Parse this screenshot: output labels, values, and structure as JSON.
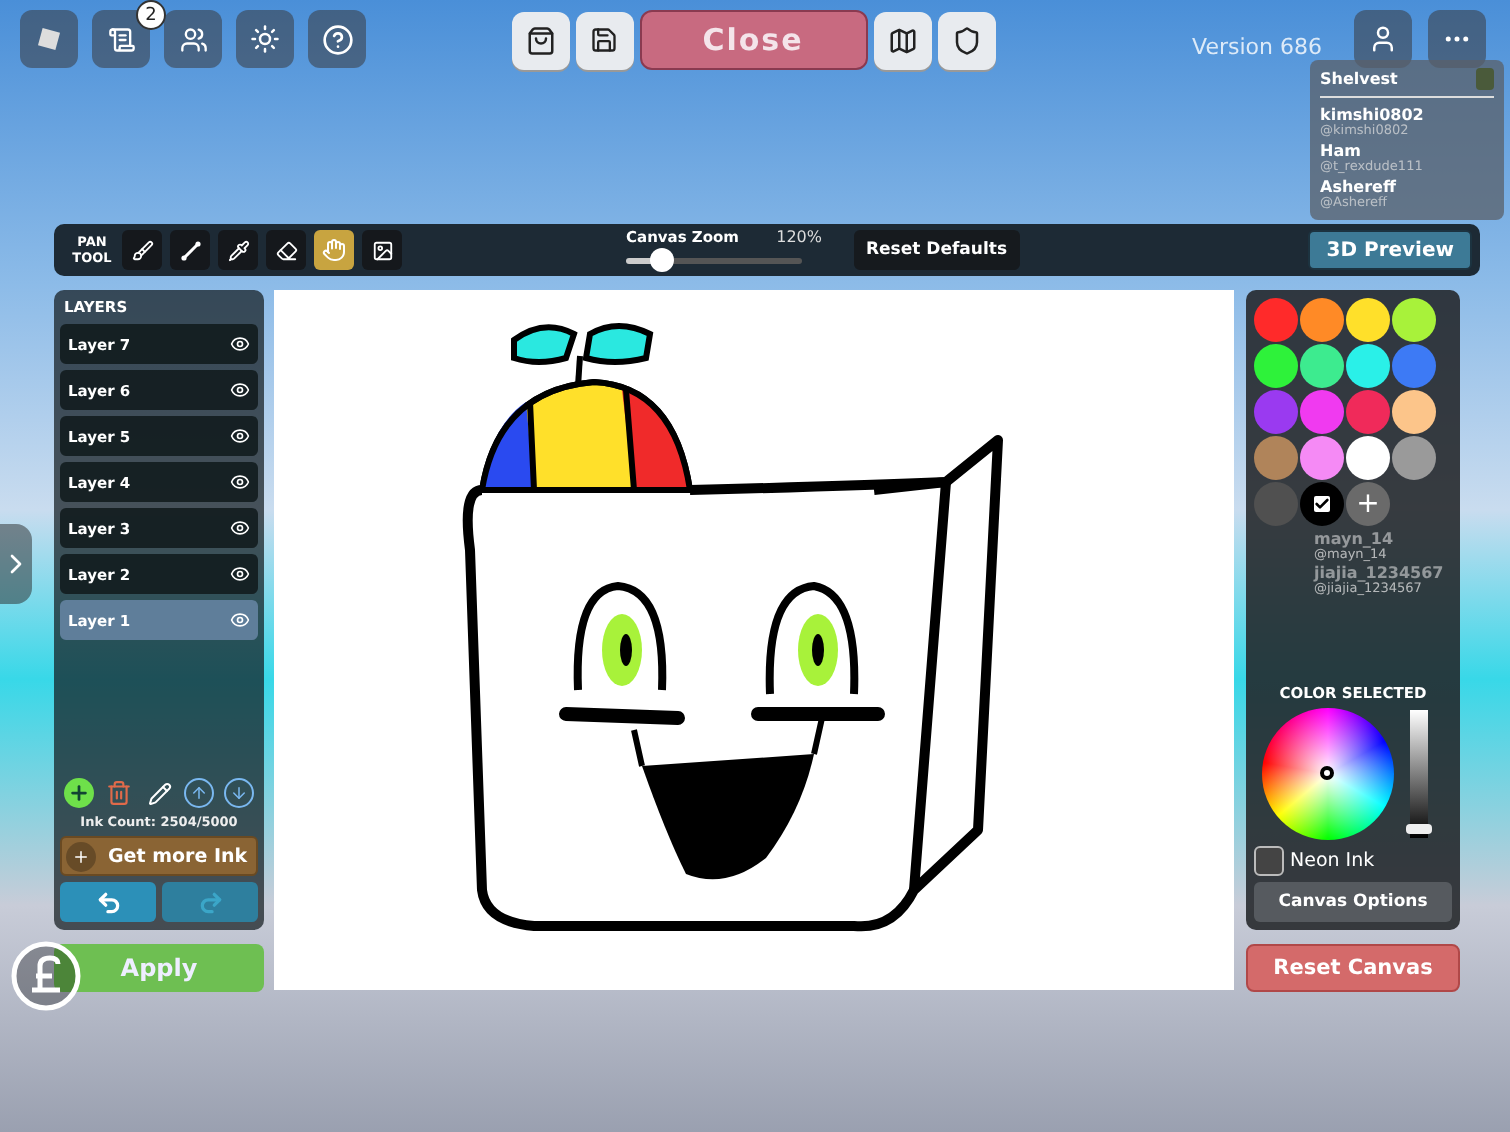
{
  "topbar": {
    "notification_count": "2",
    "close_label": "Close",
    "version": "Version 686"
  },
  "players_top": [
    {
      "name": "Shelvest"
    },
    {
      "name": "kimshi0802",
      "handle": "@kimshi0802"
    },
    {
      "name": "Ham",
      "handle": "@t_rexdude111"
    },
    {
      "name": "Ashereff",
      "handle": "@Ashereff"
    }
  ],
  "players_bottom": [
    {
      "name": "mayn_14",
      "handle": "@mayn_14"
    },
    {
      "name": "jiajia_1234567",
      "handle": "@jiajia_1234567"
    }
  ],
  "toolbar": {
    "tool_name": "PAN TOOL",
    "tools": [
      {
        "kind": "brush",
        "selected": false
      },
      {
        "kind": "line",
        "selected": false
      },
      {
        "kind": "picker",
        "selected": false
      },
      {
        "kind": "eraser",
        "selected": false
      },
      {
        "kind": "pan",
        "selected": true
      },
      {
        "kind": "image",
        "selected": false
      }
    ],
    "zoom": {
      "label": "Canvas Zoom",
      "reading": "120%",
      "level": 0.2
    },
    "reset_label": "Reset Defaults",
    "preview_label": "3D Preview"
  },
  "layers": {
    "title": "LAYERS",
    "items": [
      {
        "label": "Layer 7",
        "selected": false,
        "visible": true
      },
      {
        "label": "Layer 6",
        "selected": false,
        "visible": true
      },
      {
        "label": "Layer 5",
        "selected": false,
        "visible": true
      },
      {
        "label": "Layer 4",
        "selected": false,
        "visible": true
      },
      {
        "label": "Layer 3",
        "selected": false,
        "visible": true
      },
      {
        "label": "Layer 2",
        "selected": false,
        "visible": true
      },
      {
        "label": "Layer 1",
        "selected": true,
        "visible": true
      }
    ],
    "ink_count": "Ink Count: 2504/5000",
    "get_ink_label": "Get more Ink",
    "undo_disabled": false,
    "redo_disabled": true,
    "apply_label": "Apply"
  },
  "palette": {
    "swatches": [
      {
        "color": "#ff2a2a",
        "selected": false
      },
      {
        "color": "#ff8a26",
        "selected": false
      },
      {
        "color": "#ffe02a",
        "selected": false
      },
      {
        "color": "#a8f23a",
        "selected": false
      },
      {
        "color": "#2ef23a",
        "selected": false
      },
      {
        "color": "#3deb8f",
        "selected": false
      },
      {
        "color": "#2af0e8",
        "selected": false
      },
      {
        "color": "#3d7af5",
        "selected": false
      },
      {
        "color": "#9a3af0",
        "selected": false
      },
      {
        "color": "#f03af0",
        "selected": false
      },
      {
        "color": "#f02a5a",
        "selected": false
      },
      {
        "color": "#fcc58a",
        "selected": false
      },
      {
        "color": "#b0845a",
        "selected": false
      },
      {
        "color": "#f58af5",
        "selected": false
      },
      {
        "color": "#ffffff",
        "selected": false
      },
      {
        "color": "#9a9a9a",
        "selected": false
      },
      {
        "color": "#505050",
        "selected": false
      },
      {
        "color": "#000000",
        "selected": true
      }
    ],
    "add_label": "+",
    "color_selected_label": "COLOR SELECTED",
    "brightness": {
      "level": 0.03
    },
    "neon_ink": {
      "label": "Neon Ink",
      "checked": false
    },
    "canvas_options_label": "Canvas Options",
    "reset_canvas_label": "Reset Canvas"
  }
}
